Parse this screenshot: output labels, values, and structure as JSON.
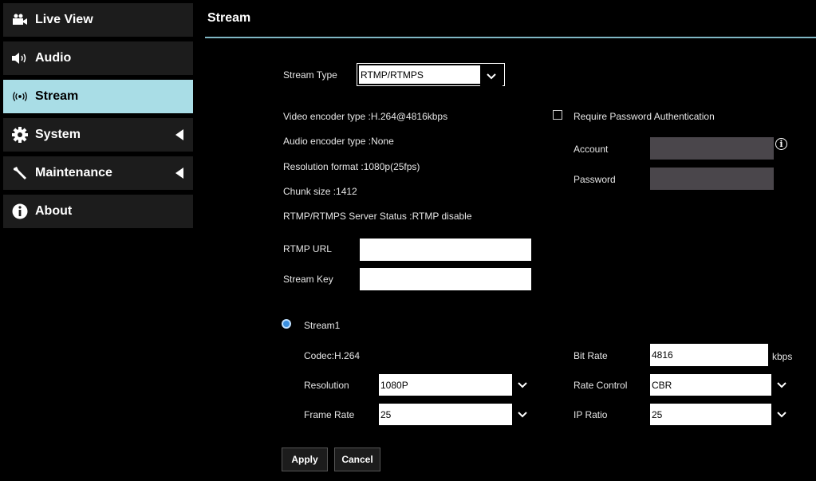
{
  "sidebar": {
    "items": [
      {
        "label": "Live View",
        "icon": "video-camera-icon"
      },
      {
        "label": "Audio",
        "icon": "speaker-icon"
      },
      {
        "label": "Stream",
        "icon": "broadcast-icon"
      },
      {
        "label": "System",
        "icon": "gear-icon"
      },
      {
        "label": "Maintenance",
        "icon": "wrench-icon"
      },
      {
        "label": "About",
        "icon": "info-icon"
      }
    ],
    "active": "Stream"
  },
  "main": {
    "title": "Stream",
    "stream_type": {
      "label": "Stream Type",
      "value": "RTMP/RTMPS"
    },
    "info": {
      "video_encoder": "Video encoder type :H.264@4816kbps",
      "audio_encoder": "Audio encoder type :None",
      "resolution_format": "Resolution format :1080p(25fps)",
      "chunk_size": "Chunk size :1412",
      "server_status": "RTMP/RTMPS Server Status :RTMP disable"
    },
    "rtmp_url": {
      "label": "RTMP URL",
      "value": ""
    },
    "stream_key": {
      "label": "Stream Key",
      "value": ""
    },
    "auth": {
      "require_label": "Require Password Authentication",
      "checked": false,
      "account_label": "Account",
      "account_value": "",
      "password_label": "Password",
      "password_value": ""
    },
    "stream1": {
      "label": "Stream1",
      "codec": "Codec:H.264",
      "resolution_label": "Resolution",
      "resolution_value": "1080P",
      "frame_rate_label": "Frame Rate",
      "frame_rate_value": "25",
      "bit_rate_label": "Bit Rate",
      "bit_rate_value": "4816",
      "bit_rate_unit": "kbps",
      "rate_control_label": "Rate Control",
      "rate_control_value": "CBR",
      "ip_ratio_label": "IP Ratio",
      "ip_ratio_value": "25"
    },
    "buttons": {
      "apply": "Apply",
      "cancel": "Cancel"
    }
  },
  "colors": {
    "active_nav": "#a9dde6",
    "nav_bg": "#1c1c1c",
    "title_rule": "#7fb7c4",
    "radio": "#3a8fe0",
    "gray_input": "#4a464b"
  }
}
